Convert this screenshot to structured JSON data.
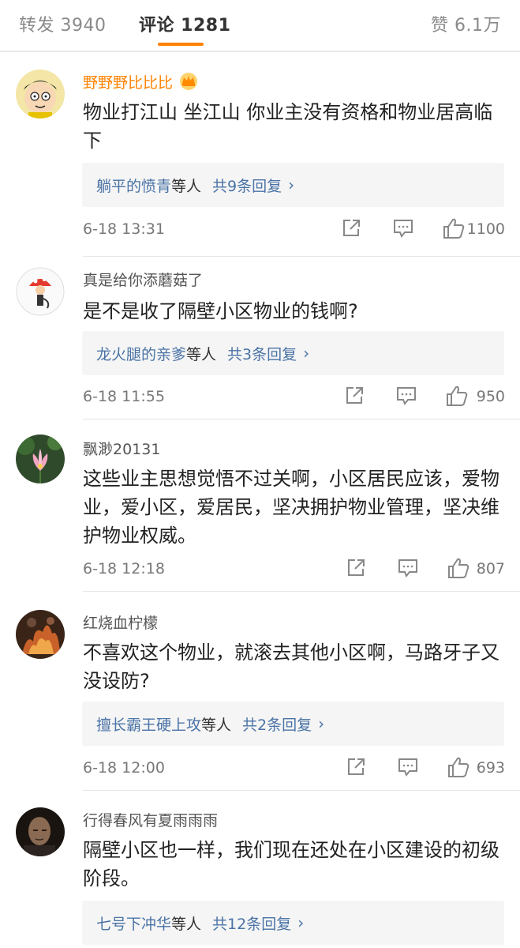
{
  "tabs": {
    "repost": "转发 3940",
    "comments": "评论 1281",
    "likes": "赞 6.1万"
  },
  "comments": [
    {
      "author": "野野野比比比",
      "content": "物业打江山 坐江山 你业主没有资格和物业居高临下",
      "reply_names": "躺平的愤青",
      "reply_etc": "等人",
      "reply_count": "共9条回复",
      "time": "6-18 13:31",
      "likes": "1100"
    },
    {
      "author": "真是给你添蘑菇了",
      "content": "是不是收了隔壁小区物业的钱啊?",
      "reply_names": "龙火腿的亲爹",
      "reply_etc": "等人",
      "reply_count": "共3条回复",
      "time": "6-18 11:55",
      "likes": "950"
    },
    {
      "author": "飘渺20131",
      "content": "这些业主思想觉悟不过关啊，小区居民应该，爱物业，爱小区，爱居民，坚决拥护物业管理，坚决维护物业权威。",
      "time": "6-18 12:18",
      "likes": "807"
    },
    {
      "author": "红烧血柠檬",
      "content": "不喜欢这个物业，就滚去其他小区啊，马路牙子又没设防?",
      "reply_names": "擅长霸王硬上攻",
      "reply_etc": "等人",
      "reply_count": "共2条回复",
      "time": "6-18 12:00",
      "likes": "693"
    },
    {
      "author": "行得春风有夏雨雨雨",
      "content": "隔壁小区也一样，我们现在还处在小区建设的初级阶段。",
      "reply_names": "七号下冲华",
      "reply_etc": "等人",
      "reply_count": "共12条回复"
    }
  ],
  "colors": {
    "accent": "#ff8200",
    "link": "#4a73a6",
    "reply_bg": "#f5f5f5"
  }
}
